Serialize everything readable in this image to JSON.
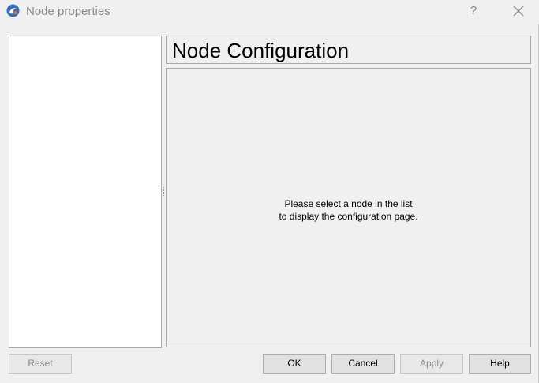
{
  "window": {
    "title": "Node properties",
    "help_glyph": "?",
    "icons": {
      "app": "app-logo-icon",
      "close": "close-icon"
    }
  },
  "header": {
    "title": "Node Configuration"
  },
  "content": {
    "message_line1": "Please select a node in the list",
    "message_line2": "to display the configuration page."
  },
  "buttons": {
    "reset": "Reset",
    "ok": "OK",
    "cancel": "Cancel",
    "apply": "Apply",
    "help": "Help"
  },
  "colors": {
    "background": "#f0f0f0",
    "list_background": "#ffffff",
    "border": "#a9a9a9",
    "disabled_text": "#8c8c8c"
  }
}
